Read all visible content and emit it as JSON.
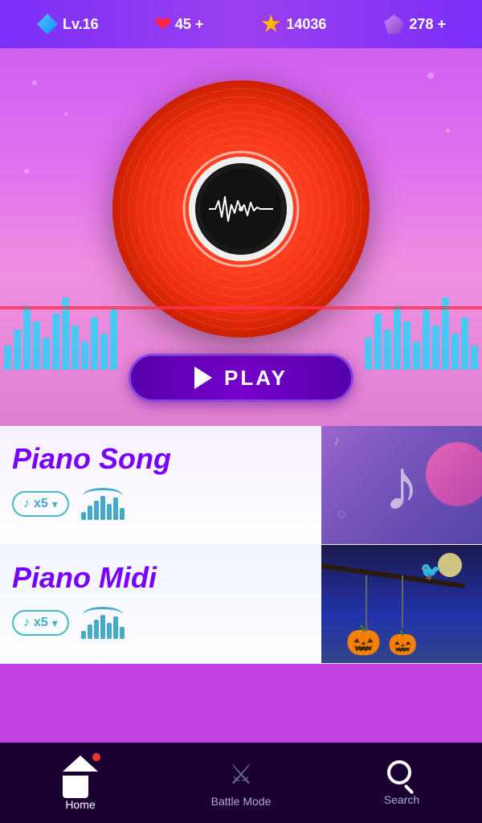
{
  "topBar": {
    "level": "Lv.16",
    "hearts": "45",
    "gold": "14036",
    "gems": "278",
    "plus": "+"
  },
  "playButton": {
    "label": "PLAY"
  },
  "songs": [
    {
      "title": "Piano Song",
      "countLabel": "♪ x5",
      "type": "piano-song"
    },
    {
      "title": "Piano Midi",
      "countLabel": "♪ x5",
      "type": "piano-midi"
    }
  ],
  "bottomNav": {
    "items": [
      {
        "id": "home",
        "label": "Home",
        "active": true
      },
      {
        "id": "battle",
        "label": "Battle Mode",
        "active": false
      },
      {
        "id": "search",
        "label": "Search",
        "active": false
      }
    ]
  }
}
